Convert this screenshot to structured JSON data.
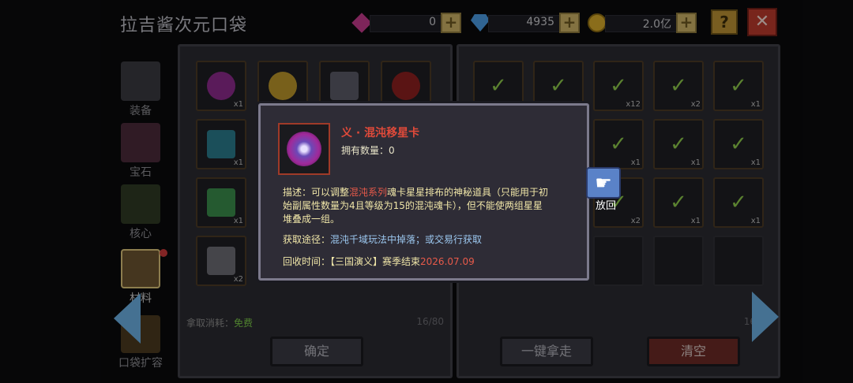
{
  "header": {
    "title": "拉吉酱次元口袋",
    "currency": [
      {
        "icon": "pink-gem-icon",
        "value": "0"
      },
      {
        "icon": "blue-diamond-icon",
        "value": "4935"
      },
      {
        "icon": "gold-coin-icon",
        "value": "2.0亿"
      }
    ],
    "help_label": "?",
    "close_label": "✕"
  },
  "sidebar": {
    "items": [
      {
        "label": "装备",
        "icon": "armor-icon"
      },
      {
        "label": "宝石",
        "icon": "gem-icon"
      },
      {
        "label": "核心",
        "icon": "core-icon"
      },
      {
        "label": "材料",
        "icon": "material-icon"
      },
      {
        "label": "口袋扩容",
        "icon": "expand-icon"
      }
    ]
  },
  "left_panel": {
    "slots": [
      {
        "count": "x1",
        "color": "#8a2a8a"
      },
      {
        "count": "",
        "color": "#b8942a"
      },
      {
        "count": "",
        "color": "#5a5a66"
      },
      {
        "count": "",
        "color": "#8a2020"
      },
      {
        "count": "x1",
        "color": "#2a7a8a"
      },
      {
        "count": "x1",
        "color": "#3a8a4a"
      },
      {
        "count": "x2",
        "color": "#6a6a72"
      }
    ],
    "cost_label": "拿取消耗：",
    "cost_value": "免费",
    "capacity": "16/80",
    "confirm_label": "确定"
  },
  "right_panel": {
    "counts": [
      "",
      "",
      "x12",
      "x2",
      "x1",
      "",
      "x1",
      "x1",
      "x1",
      "x2",
      "x1",
      "x1"
    ],
    "capacity": "16",
    "take_all_label": "一键拿走",
    "clear_label": "清空"
  },
  "tooltip": {
    "name": "义 · 混沌移星卡",
    "own_label": "拥有数量：",
    "own_value": "0",
    "desc_label": "描述：",
    "desc_pre": "可以调整",
    "desc_highlight": "混沌系列",
    "desc_post": "魂卡星星排布的神秘道具（只能用于初",
    "desc_line2": "始副属性数量为4且等级为15的混沌魂卡），但不能使两组星星",
    "desc_line3": "堆叠成一组。",
    "source_label": "获取途径：",
    "source_value": "混沌千域玩法中掉落；或交易行获取",
    "recycle_label": "回收时间：",
    "recycle_value": "【三国演义】赛季结束",
    "recycle_date": "2026.07.09"
  },
  "put_back": {
    "label": "放回",
    "icon": "hand-icon"
  }
}
